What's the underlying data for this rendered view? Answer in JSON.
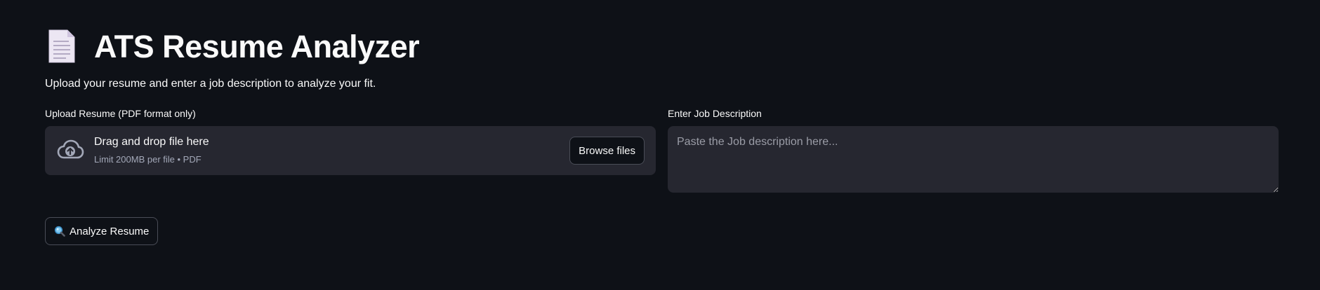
{
  "header": {
    "title": "ATS Resume Analyzer",
    "title_icon": "document-icon",
    "subtitle": "Upload your resume and enter a job description to analyze your fit."
  },
  "upload": {
    "label": "Upload Resume (PDF format only)",
    "drop_text": "Drag and drop file here",
    "hint": "Limit 200MB per file • PDF",
    "browse_label": "Browse files",
    "icon": "cloud-upload-icon"
  },
  "job_description": {
    "label": "Enter Job Description",
    "placeholder": "Paste the Job description here...",
    "value": ""
  },
  "actions": {
    "analyze_label": "Analyze Resume",
    "analyze_icon": "search-icon"
  },
  "colors": {
    "background": "#0e1117",
    "surface": "#262730",
    "text": "#fafafa",
    "muted": "#a3a8b8",
    "border": "#4a4d57"
  }
}
